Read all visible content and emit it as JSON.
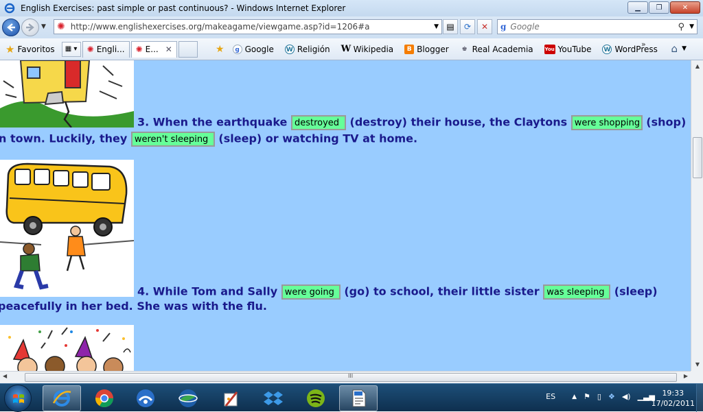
{
  "window": {
    "title": "English Exercises: past simple or past continuous? - Windows Internet Explorer",
    "minimize": "▁",
    "maximize": "❐",
    "close": "✕"
  },
  "addressbar": {
    "url": "http://www.englishexercises.org/makeagame/viewgame.asp?id=1206#a",
    "search_placeholder": "Google",
    "search_engine": "Google"
  },
  "favorites": {
    "label": "Favoritos",
    "tabs": [
      {
        "label": "Engli..."
      },
      {
        "label": "E..."
      }
    ],
    "links": [
      {
        "label": "Google",
        "icon": "google-icon"
      },
      {
        "label": "Religión",
        "icon": "wordpress-icon"
      },
      {
        "label": "Wikipedia",
        "icon": "wikipedia-icon"
      },
      {
        "label": "Blogger",
        "icon": "blogger-icon"
      },
      {
        "label": "Real Academia",
        "icon": "rae-icon"
      },
      {
        "label": "YouTube",
        "icon": "youtube-icon"
      },
      {
        "label": "WordPress",
        "icon": "wordpress-icon"
      }
    ]
  },
  "exercise": {
    "q3": {
      "prefix": "3. When the earthquake",
      "ans1": "destroyed",
      "mid1": "(destroy) their house, the Claytons",
      "ans2": "were shopping",
      "mid2": "(shop)",
      "line2_prefix": "n town. Luckily, they",
      "ans3": "weren't sleeping",
      "line2_suffix": "(sleep) or watching TV at home."
    },
    "q4": {
      "prefix": "4. While Tom and Sally",
      "ans1": "were going",
      "mid1": "(go) to school, their little sister",
      "ans2": "was sleeping",
      "mid2": "(sleep)",
      "line2": "peacefully in her bed. She was with the flu."
    }
  },
  "scrollbar": {
    "h_grip": "III"
  },
  "taskbar": {
    "lang": "ES",
    "time": "19:33",
    "date": "17/02/2011"
  }
}
